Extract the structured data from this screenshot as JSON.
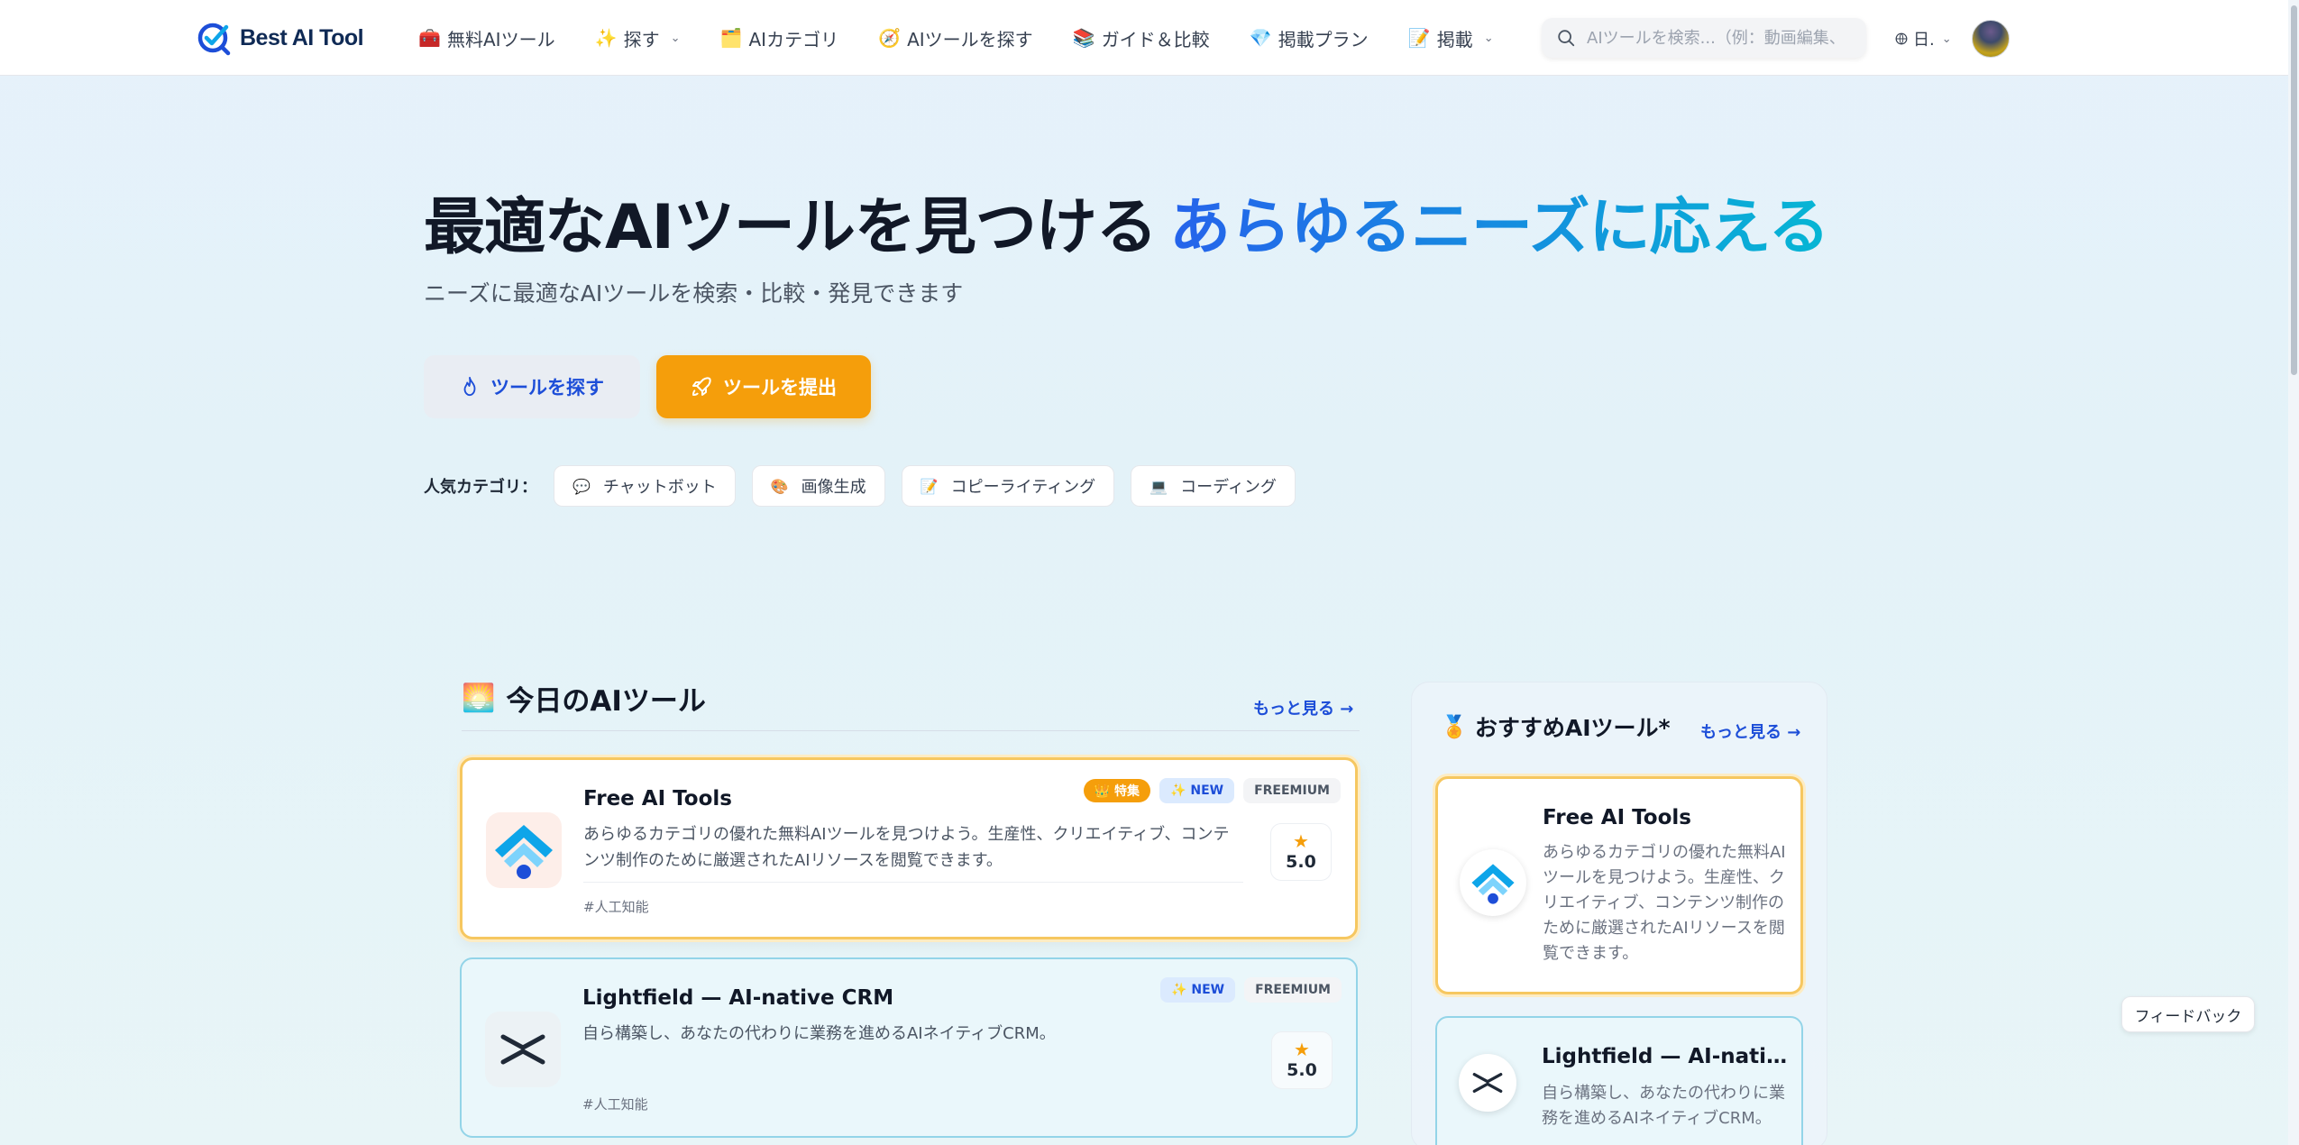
{
  "header": {
    "logo_text": "Best AI Tool",
    "nav": [
      {
        "label": "無料AIツール",
        "icon": "🧰",
        "dropdown": false
      },
      {
        "label": "探す",
        "icon": "✨",
        "dropdown": true
      },
      {
        "label": "AIカテゴリ",
        "icon": "🗂️",
        "dropdown": false
      },
      {
        "label": "AIツールを探す",
        "icon": "🧭",
        "dropdown": false
      },
      {
        "label": "ガイド＆比較",
        "icon": "📚",
        "dropdown": false
      },
      {
        "label": "掲載プラン",
        "icon": "💎",
        "dropdown": false
      },
      {
        "label": "掲載",
        "icon": "📝",
        "dropdown": true
      }
    ],
    "search_placeholder": "AIツールを検索...（例：動画編集、",
    "language": "日.",
    "chev": "⌄"
  },
  "hero": {
    "title": "最適なAIツールを見つける",
    "title_accent": "あらゆるニーズに応える",
    "subtitle": "ニーズに最適なAIツールを検索・比較・発見できます",
    "btn_explore": "ツールを探す",
    "btn_submit": "ツールを提出",
    "popular_label": "人気カテゴリ：",
    "categories": [
      {
        "label": "チャットボット",
        "icon": "💬"
      },
      {
        "label": "画像生成",
        "icon": "🎨"
      },
      {
        "label": "コピーライティング",
        "icon": "📝"
      },
      {
        "label": "コーディング",
        "icon": "💻"
      }
    ]
  },
  "today": {
    "emoji": "🌅",
    "title": "今日のAIツール",
    "more": "もっと見る →",
    "tools": [
      {
        "name": "Free AI Tools",
        "desc": "あらゆるカテゴリの優れた無料AIツールを見つけよう。生産性、クリエイティブ、コンテンツ制作のために厳選されたAIリソースを閲覧できます。",
        "tag": "#人工知能",
        "badge_featured": "👑 特集",
        "badge_new": "✨ NEW",
        "badge_pricing": "FREEMIUM",
        "rating_star": "★",
        "rating": "5.0"
      },
      {
        "name": "Lightfield — AI-native CRM",
        "desc": "自ら構築し、あなたの代わりに業務を進めるAIネイティブCRM。",
        "tag": "#人工知能",
        "badge_new": "✨ NEW",
        "badge_pricing": "FREEMIUM",
        "rating_star": "★",
        "rating": "5.0"
      }
    ]
  },
  "recommended": {
    "emoji": "🏅",
    "title": "おすすめAIツール*",
    "more": "もっと見る →",
    "tools": [
      {
        "name": "Free AI Tools",
        "desc": "あらゆるカテゴリの優れた無料AIツールを見つけよう。生産性、クリエイティブ、コンテンツ制作のために厳選されたAIリソースを閲覧できます。"
      },
      {
        "name": "Lightfield — AI-native CRM",
        "desc": "自ら構築し、あなたの代わりに業務を進めるAIネイティブCRM。"
      }
    ]
  },
  "feedback": "フィードバック",
  "colors": {
    "accent_blue": "#2563eb",
    "accent_cyan": "#06b6d4",
    "submit_orange": "#f59e0b",
    "featured_border": "#f6c760",
    "new_border": "#93d4e8"
  }
}
